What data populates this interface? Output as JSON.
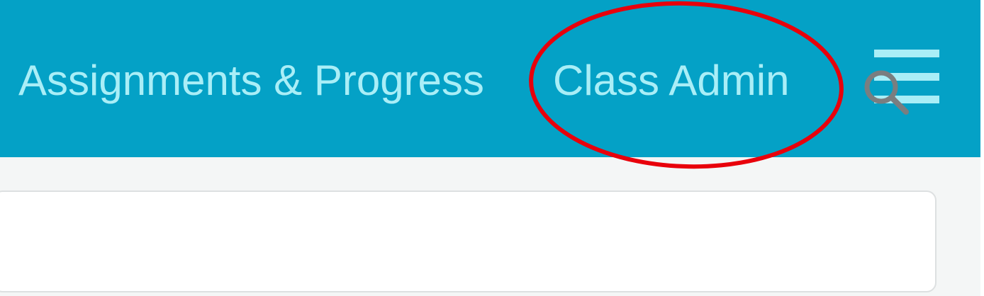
{
  "navbar": {
    "links": {
      "assignments": "Assignments & Progress",
      "class_admin": "Class Admin"
    },
    "menu_icon": "hamburger-menu-icon",
    "background_color": "#04a1c6",
    "text_color": "#a9eef7"
  },
  "search": {
    "value": "",
    "icon": "magnifier-icon"
  },
  "annotation": {
    "shape": "ellipse",
    "color": "#e8000b",
    "target": "Class Admin"
  }
}
